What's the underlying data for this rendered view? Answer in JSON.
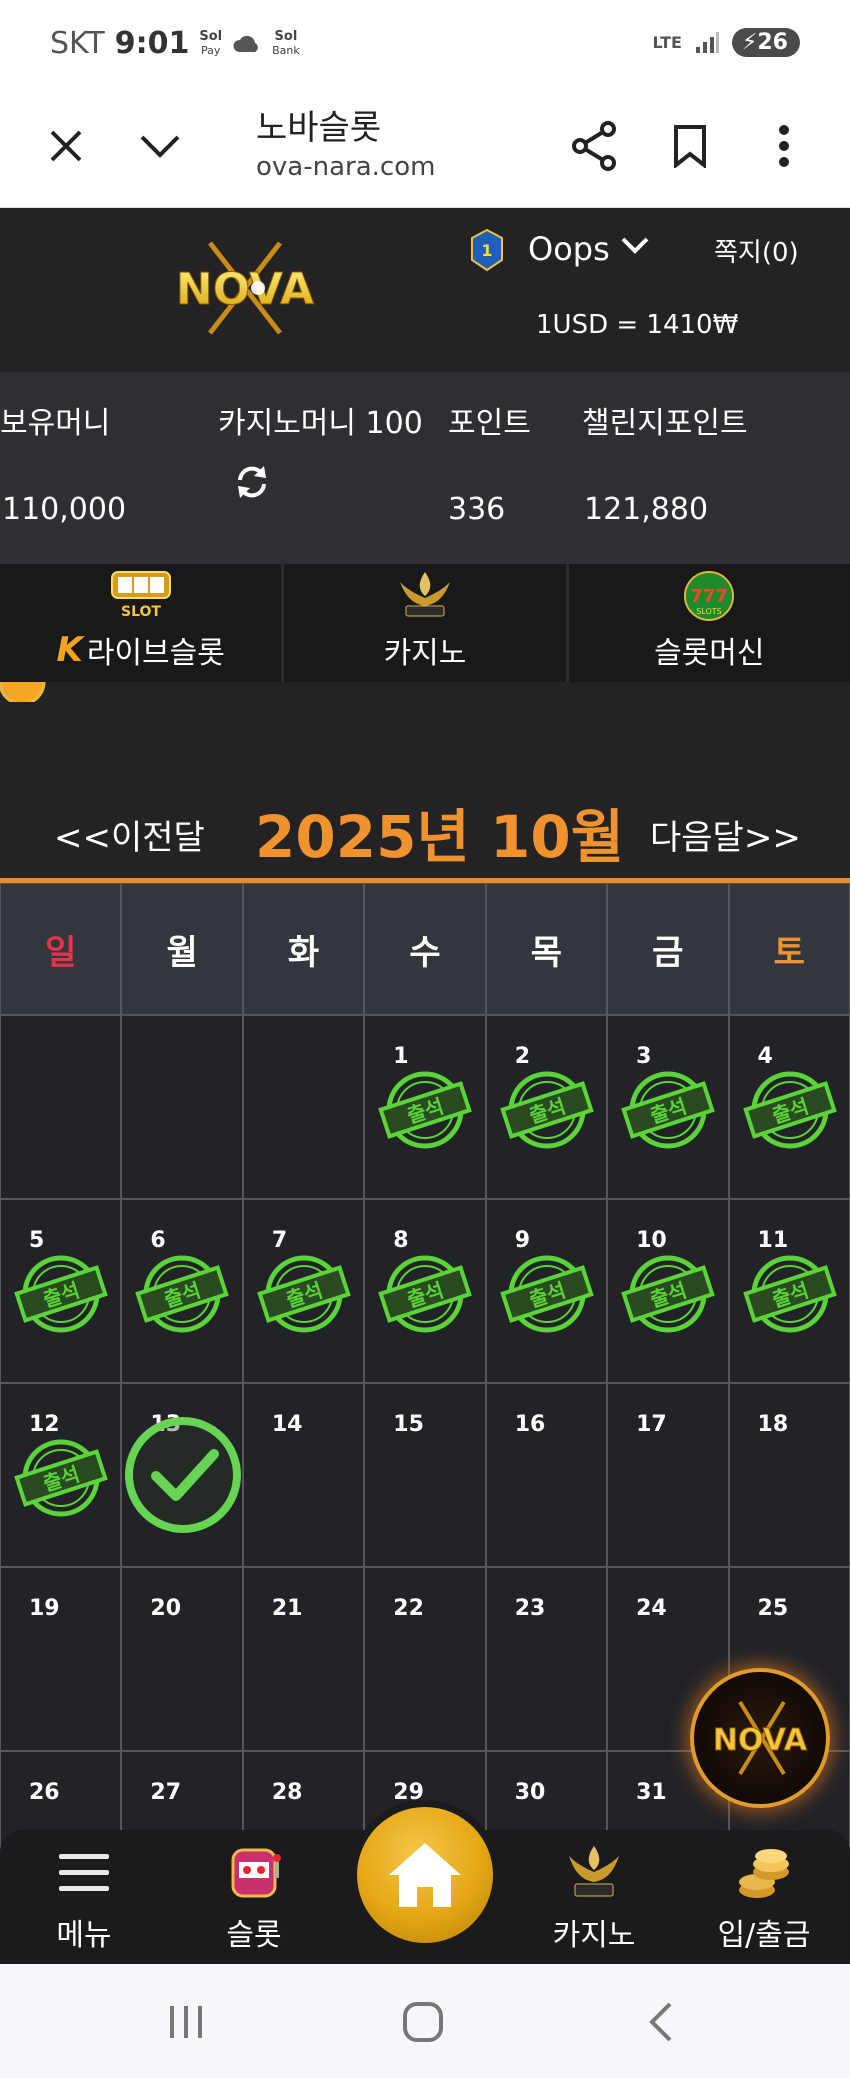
{
  "status_bar": {
    "carrier": "SKT",
    "time": "9:01",
    "app1_top": "Sol",
    "app1_bottom": "Pay",
    "app2_top": "Sol",
    "app2_bottom": "Bank",
    "network": "LTE",
    "battery": "26"
  },
  "browser": {
    "title": "노바슬롯",
    "url": "ova-nara.com"
  },
  "header": {
    "logo_text": "NOVA",
    "level": "1",
    "username": "Oops",
    "messages": "쪽지(0)",
    "exchange_rate": "1USD = 1410₩"
  },
  "balance": {
    "holding_label": "보유머니",
    "holding_value": "110,000",
    "casino_label": "카지노머니 100",
    "points_label": "포인트",
    "points_value": "336",
    "challenge_label": "챌린지포인트",
    "challenge_value": "121,880"
  },
  "categories": [
    {
      "label": "라이브슬롯",
      "icon": "live-slot-icon"
    },
    {
      "label": "카지노",
      "icon": "kslot-casino-icon"
    },
    {
      "label": "슬롯머신",
      "icon": "777-slots-icon"
    }
  ],
  "calendar": {
    "prev": "<<이전달",
    "title": "2025년 10월",
    "next": "다음달>>",
    "weekdays": [
      "일",
      "월",
      "화",
      "수",
      "목",
      "금",
      "토"
    ],
    "weekday_colors": [
      "#e8334a",
      "#ffffff",
      "#ffffff",
      "#ffffff",
      "#ffffff",
      "#ffffff",
      "#f0922e"
    ],
    "stamp_text": "출석",
    "weeks": [
      [
        {
          "d": ""
        },
        {
          "d": ""
        },
        {
          "d": ""
        },
        {
          "d": "1",
          "s": "stamp"
        },
        {
          "d": "2",
          "s": "stamp"
        },
        {
          "d": "3",
          "s": "stamp"
        },
        {
          "d": "4",
          "s": "stamp"
        }
      ],
      [
        {
          "d": "5",
          "s": "stamp"
        },
        {
          "d": "6",
          "s": "stamp"
        },
        {
          "d": "7",
          "s": "stamp"
        },
        {
          "d": "8",
          "s": "stamp"
        },
        {
          "d": "9",
          "s": "stamp"
        },
        {
          "d": "10",
          "s": "stamp"
        },
        {
          "d": "11",
          "s": "stamp"
        }
      ],
      [
        {
          "d": "12",
          "s": "stamp"
        },
        {
          "d": "13",
          "s": "check"
        },
        {
          "d": "14"
        },
        {
          "d": "15"
        },
        {
          "d": "16"
        },
        {
          "d": "17"
        },
        {
          "d": "18"
        }
      ],
      [
        {
          "d": "19"
        },
        {
          "d": "20"
        },
        {
          "d": "21"
        },
        {
          "d": "22"
        },
        {
          "d": "23"
        },
        {
          "d": "24"
        },
        {
          "d": "25"
        }
      ],
      [
        {
          "d": "26"
        },
        {
          "d": "27"
        },
        {
          "d": "28"
        },
        {
          "d": "29"
        },
        {
          "d": "30"
        },
        {
          "d": "31"
        },
        {
          "d": ""
        }
      ]
    ]
  },
  "bottom_nav": {
    "menu": "메뉴",
    "slot": "슬롯",
    "casino": "카지노",
    "deposit": "입/출금"
  },
  "colors": {
    "accent": "#f0922e",
    "stamp_green": "#5bd43a",
    "background": "#232326"
  }
}
